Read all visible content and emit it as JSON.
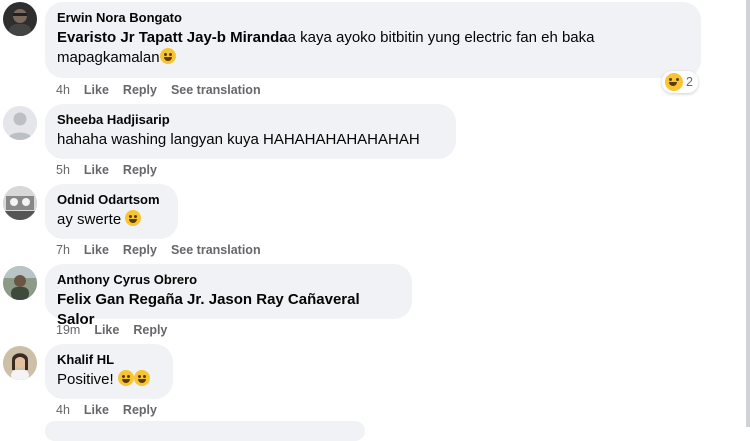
{
  "comments": [
    {
      "author": "Erwin Nora Bongato",
      "mention": "Evaristo Jr Tapatt Jay-b Miranda",
      "text_line1": "a kaya ayoko bitbitin yung electric fan eh baka",
      "text_line2": "mapagkamalan",
      "time": "4h",
      "like": "Like",
      "reply": "Reply",
      "translate": "See translation",
      "reaction_count": "2",
      "avatar_icon": "profile-photo-dark"
    },
    {
      "author": "Sheeba Hadjisarip",
      "text": "hahaha washing langyan kuya HAHAHAHAHAHAHAH",
      "time": "5h",
      "like": "Like",
      "reply": "Reply",
      "avatar_icon": "default-profile-icon"
    },
    {
      "author": "Odnid Odartsom",
      "text": "ay swerte",
      "time": "7h",
      "like": "Like",
      "reply": "Reply",
      "translate": "See translation",
      "avatar_icon": "profile-photo-bw"
    },
    {
      "author": "Anthony Cyrus Obrero",
      "mention": "Felix Gan Regaña Jr. Jason Ray Cañaveral Salor",
      "time": "19m",
      "like": "Like",
      "reply": "Reply",
      "avatar_icon": "profile-photo-outdoor"
    },
    {
      "author": "Khalif HL",
      "text": "Positive!",
      "time": "4h",
      "like": "Like",
      "reply": "Reply",
      "avatar_icon": "profile-photo-woman"
    }
  ],
  "colors": {
    "bubble": "#f0f2f5",
    "secondary_text": "#65676b",
    "primary_text": "#050505",
    "emoji": "#f7c531"
  }
}
